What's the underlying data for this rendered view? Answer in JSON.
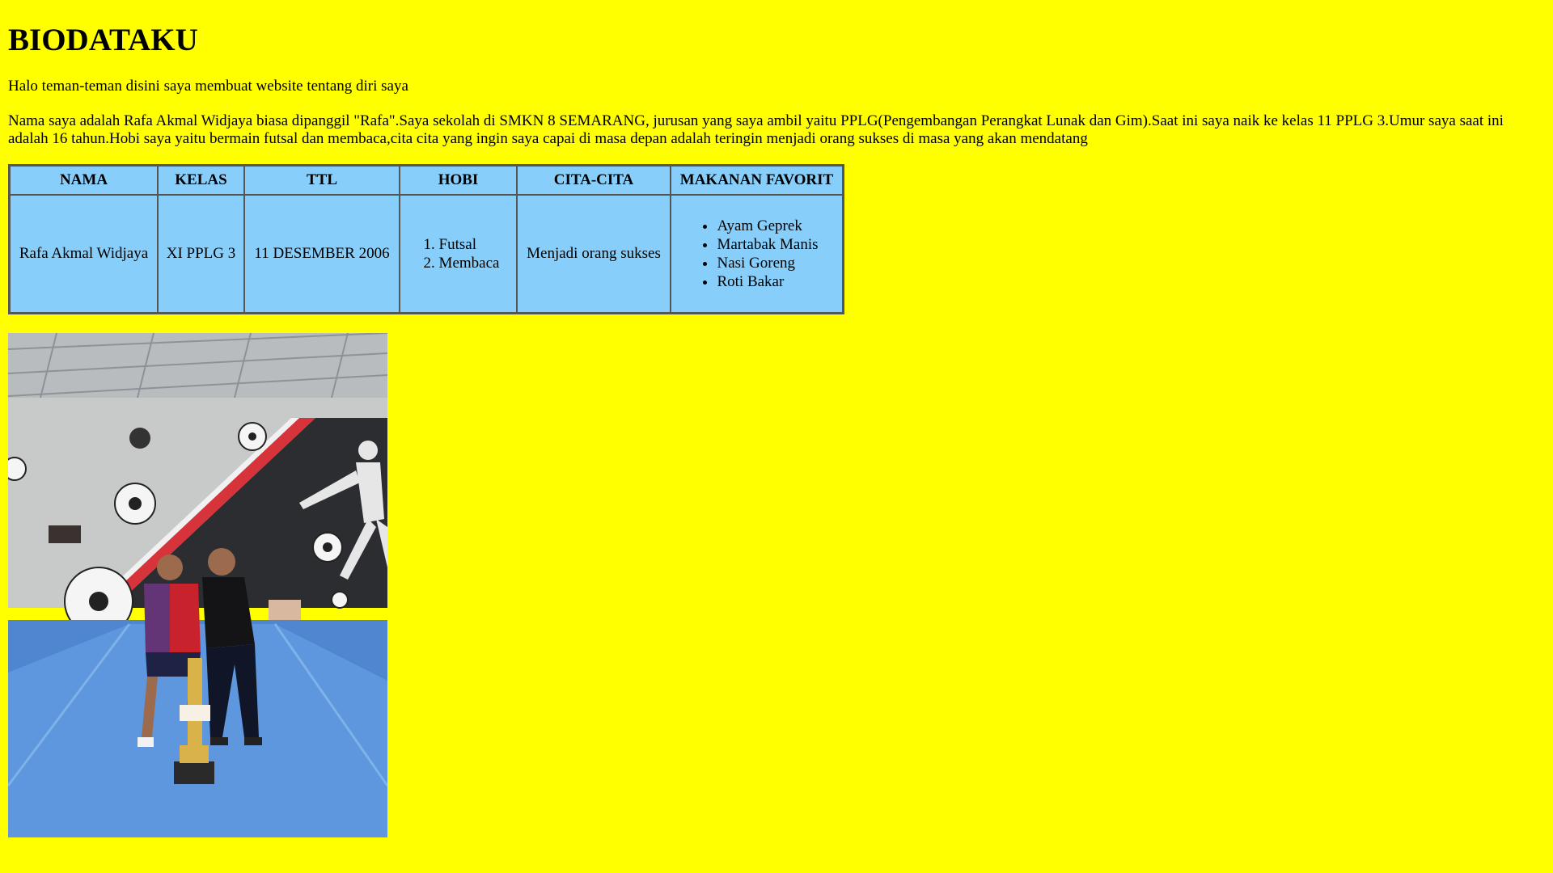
{
  "page": {
    "title": "BIODATAKU",
    "intro": "Halo teman-teman disini saya membuat website tentang diri saya",
    "about": "Nama saya adalah Rafa Akmal Widjaya biasa dipanggil \"Rafa\".Saya sekolah di SMKN 8 SEMARANG, jurusan yang saya ambil yaitu PPLG(Pengembangan Perangkat Lunak dan Gim).Saat ini saya naik ke kelas 11 PPLG 3.Umur saya saat ini adalah 16 tahun.Hobi saya yaitu bermain futsal dan membaca,cita cita yang ingin saya capai di masa depan adalah teringin menjadi orang sukses di masa yang akan mendatang"
  },
  "table": {
    "headers": [
      "NAMA",
      "KELAS",
      "TTL",
      "HOBI",
      "CITA-CITA",
      "MAKANAN FAVORIT"
    ],
    "row": {
      "nama": "Rafa Akmal Widjaya",
      "kelas": "XI PPLG 3",
      "ttl": "11 DESEMBER 2006",
      "hobi": [
        "Futsal",
        "Membaca"
      ],
      "cita": "Menjadi orang sukses",
      "makanan": [
        "Ayam Geprek",
        "Martabak Manis",
        "Nasi Goreng",
        "Roti Bakar"
      ]
    },
    "colors": {
      "background": "#87cefa",
      "border": "#555555"
    }
  },
  "colors": {
    "page_background": "#ffff00"
  }
}
